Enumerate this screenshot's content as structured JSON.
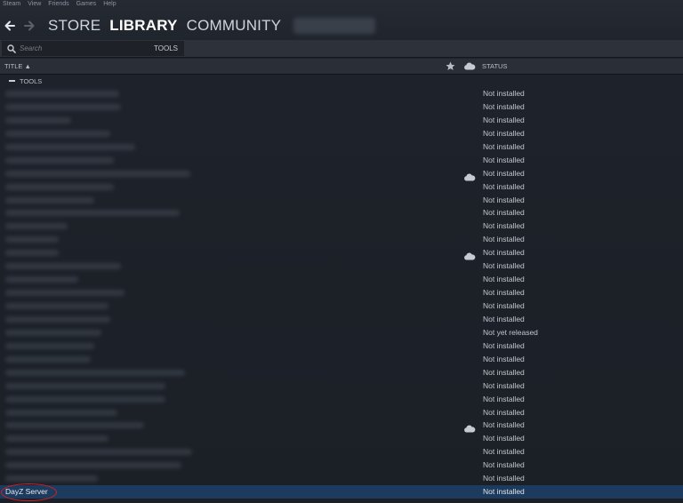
{
  "menu": [
    "Steam",
    "View",
    "Friends",
    "Games",
    "Help"
  ],
  "nav": {
    "store": "STORE",
    "library": "LIBRARY",
    "community": "COMMUNITY"
  },
  "toolbar": {
    "search_placeholder": "Search",
    "filter_label": "TOOLS"
  },
  "columns": {
    "title": "TITLE ▲",
    "status": "STATUS"
  },
  "group": {
    "label": "TOOLS"
  },
  "rows": [
    {
      "status": "Not installed",
      "cloud": false
    },
    {
      "status": "Not installed",
      "cloud": false
    },
    {
      "status": "Not installed",
      "cloud": false
    },
    {
      "status": "Not installed",
      "cloud": false
    },
    {
      "status": "Not installed",
      "cloud": false
    },
    {
      "status": "Not installed",
      "cloud": false
    },
    {
      "status": "Not installed",
      "cloud": true
    },
    {
      "status": "Not installed",
      "cloud": false
    },
    {
      "status": "Not installed",
      "cloud": false
    },
    {
      "status": "Not installed",
      "cloud": false
    },
    {
      "status": "Not installed",
      "cloud": false
    },
    {
      "status": "Not installed",
      "cloud": false
    },
    {
      "status": "Not installed",
      "cloud": true
    },
    {
      "status": "Not installed",
      "cloud": false
    },
    {
      "status": "Not installed",
      "cloud": false
    },
    {
      "status": "Not installed",
      "cloud": false
    },
    {
      "status": "Not installed",
      "cloud": false
    },
    {
      "status": "Not installed",
      "cloud": false
    },
    {
      "status": "Not yet released",
      "cloud": false
    },
    {
      "status": "Not installed",
      "cloud": false
    },
    {
      "status": "Not installed",
      "cloud": false
    },
    {
      "status": "Not installed",
      "cloud": false
    },
    {
      "status": "Not installed",
      "cloud": false
    },
    {
      "status": "Not installed",
      "cloud": false
    },
    {
      "status": "Not installed",
      "cloud": false
    },
    {
      "status": "Not installed",
      "cloud": true
    },
    {
      "status": "Not installed",
      "cloud": false
    },
    {
      "status": "Not installed",
      "cloud": false
    },
    {
      "status": "Not installed",
      "cloud": false
    },
    {
      "status": "Not installed",
      "cloud": false
    }
  ],
  "selected_row": {
    "title": "DayZ Server",
    "status": "Not installed"
  },
  "colors": {
    "selected_bg": "#1d3b5e",
    "highlight": "#d0202a",
    "background": "#1b2028"
  }
}
